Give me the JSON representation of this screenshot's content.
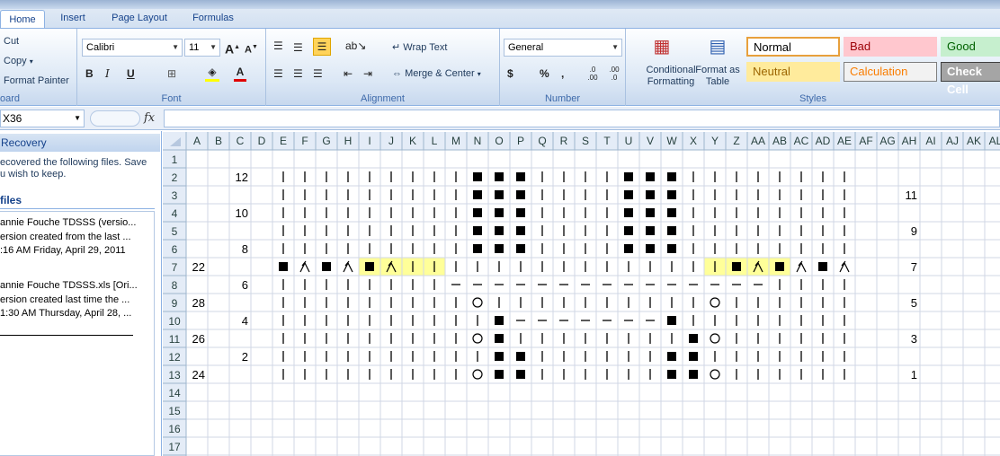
{
  "tabs": [
    "Home",
    "Insert",
    "Page Layout",
    "Formulas"
  ],
  "clipboard": {
    "cut": "Cut",
    "copy": "Copy",
    "format_painter": "Format Painter",
    "label": "oard"
  },
  "font": {
    "name": "Calibri",
    "size": "11",
    "label": "Font",
    "grow": "A",
    "shrink": "A",
    "bold": "B",
    "italic": "I",
    "underline": "U",
    "color_letter": "A"
  },
  "alignment": {
    "wrap": "Wrap Text",
    "merge": "Merge & Center",
    "label": "Alignment"
  },
  "number": {
    "format": "General",
    "label": "Number",
    "currency": "$",
    "percent": "%",
    "comma": ",",
    "inc": ".0 .00",
    "dec": ".00 .0"
  },
  "styles": {
    "conditional": "Conditional Formatting",
    "format_table": "Format as Table",
    "label": "Styles",
    "cells": [
      {
        "name": "Normal",
        "bg": "#ffffff",
        "fg": "#000000",
        "border": "#e8a03c"
      },
      {
        "name": "Bad",
        "bg": "#ffc7ce",
        "fg": "#9c0006",
        "border": "#ffc7ce"
      },
      {
        "name": "Good",
        "bg": "#c6efce",
        "fg": "#006100",
        "border": "#c6efce"
      },
      {
        "name": "Neutral",
        "bg": "#ffeb9c",
        "fg": "#9c6500",
        "border": "#ffeb9c"
      },
      {
        "name": "Calculation",
        "bg": "#f2f2f2",
        "fg": "#fa7d00",
        "border": "#7f7f7f"
      },
      {
        "name": "Check Cell",
        "bg": "#a5a5a5",
        "fg": "#ffffff",
        "border": "#3f3f3f"
      }
    ]
  },
  "formula_bar": {
    "name_box": "X36",
    "fx": "fx",
    "value": ""
  },
  "recovery": {
    "title": "Recovery",
    "lines": [
      "ecovered the following files.  Save",
      "u wish to keep."
    ],
    "files_heading": "files",
    "files": [
      {
        "name": "annie Fouche TDSSS (versio...",
        "desc": "ersion created from the last ...",
        "time": ":16 AM Friday, April 29, 2011"
      },
      {
        "name": "annie Fouche TDSSS.xls  [Ori...",
        "desc": "ersion created last time the ...",
        "time": "1:30 AM Thursday, April 28, ..."
      }
    ]
  },
  "sheet": {
    "columns": [
      "A",
      "B",
      "C",
      "D",
      "E",
      "F",
      "G",
      "H",
      "I",
      "J",
      "K",
      "L",
      "M",
      "N",
      "O",
      "P",
      "Q",
      "R",
      "S",
      "T",
      "U",
      "V",
      "W",
      "X",
      "Y",
      "Z",
      "AA",
      "AB",
      "AC",
      "AD",
      "AE",
      "AF",
      "AG",
      "AH",
      "AI",
      "AJ",
      "AK",
      "AL"
    ],
    "rows": [
      "1",
      "2",
      "3",
      "4",
      "5",
      "6",
      "7",
      "8",
      "9",
      "10",
      "11",
      "12",
      "13",
      "14",
      "15",
      "16",
      "17"
    ],
    "highlight_color": "#ffff99",
    "numbers": [
      {
        "row": 2,
        "col": "C",
        "v": "12"
      },
      {
        "row": 4,
        "col": "C",
        "v": "10"
      },
      {
        "row": 6,
        "col": "C",
        "v": "8"
      },
      {
        "row": 8,
        "col": "C",
        "v": "6"
      },
      {
        "row": 10,
        "col": "C",
        "v": "4"
      },
      {
        "row": 12,
        "col": "C",
        "v": "2"
      },
      {
        "row": 7,
        "col": "A",
        "v": "22"
      },
      {
        "row": 9,
        "col": "A",
        "v": "28"
      },
      {
        "row": 11,
        "col": "A",
        "v": "26"
      },
      {
        "row": 13,
        "col": "A",
        "v": "24"
      },
      {
        "row": 3,
        "col": "AH",
        "v": "11"
      },
      {
        "row": 5,
        "col": "AH",
        "v": "9"
      },
      {
        "row": 7,
        "col": "AH",
        "v": "7"
      },
      {
        "row": 9,
        "col": "AH",
        "v": "5"
      },
      {
        "row": 11,
        "col": "AH",
        "v": "3"
      },
      {
        "row": 13,
        "col": "AH",
        "v": "1"
      }
    ],
    "pattern_start_col": "E",
    "pattern": [
      "|||||||||BBB||||BBB||||||||",
      "|||||||||BBB||||BBB||||||||",
      "|||||||||BBB||||BBB||||||||",
      "|||||||||BBB||||BBB||||||||",
      "|||||||||BBB||||BBB||||||||",
      "BVBVBV|||||||||||||||BVBVBV",
      "||||||||---------------||||",
      "|||||||||O||||||||||O||||||",
      "||||||||||B-------B||||||||",
      "|||||||||OB||||||||BO||||||",
      "||||||||||BB||||||BB|||||||",
      "|||||||||OBB||||||BBO||||||"
    ],
    "highlights": [
      {
        "row": 7,
        "cols": [
          "I",
          "J",
          "K",
          "L"
        ]
      },
      {
        "row": 7,
        "cols": [
          "Y",
          "Z",
          "AA",
          "AB"
        ]
      }
    ]
  }
}
